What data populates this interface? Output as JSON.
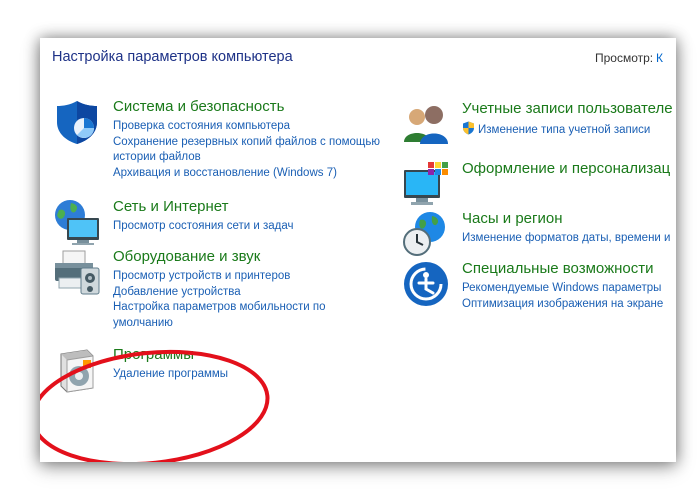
{
  "header": {
    "title": "Настройка параметров компьютера",
    "view_label": "Просмотр:",
    "view_value": "К"
  },
  "categories": [
    {
      "title": "Система и безопасность",
      "icon": "shield-icon",
      "links": [
        "Проверка состояния компьютера",
        "Сохранение резервных копий файлов с помощью истории файлов",
        "Архивация и восстановление (Windows 7)"
      ]
    },
    {
      "title": "Сеть и Интернет",
      "icon": "network-globe-icon",
      "links": [
        "Просмотр состояния сети и задач"
      ]
    },
    {
      "title": "Оборудование и звук",
      "icon": "printer-icon",
      "links": [
        "Просмотр устройств и принтеров",
        "Добавление устройства",
        "Настройка параметров мобильности по умолчанию"
      ]
    },
    {
      "title": "Программы",
      "icon": "programs-disc-icon",
      "links": [
        "Удаление программы"
      ]
    },
    {
      "title": "Учетные записи пользователе",
      "icon": "users-icon",
      "links": [
        "Изменение типа учетной записи"
      ]
    },
    {
      "title": "Оформление и персонализац",
      "icon": "appearance-monitor-icon",
      "links": []
    },
    {
      "title": "Часы и регион",
      "icon": "clock-globe-icon",
      "links": [
        "Изменение форматов даты, времени и"
      ]
    },
    {
      "title": "Специальные возможности",
      "icon": "accessibility-icon",
      "links": [
        "Рекомендуемые Windows параметры",
        "Оптимизация изображения на экране"
      ]
    }
  ],
  "colors": {
    "header": "#1e3287",
    "category_title": "#1a7a1a",
    "link": "#1a5fb4",
    "highlight_ellipse": "#e3101b"
  }
}
